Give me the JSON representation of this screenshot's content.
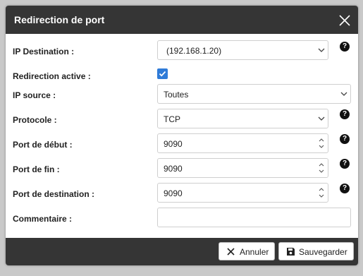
{
  "dialog": {
    "title": "Redirection de port",
    "close_icon": "close-icon"
  },
  "form": {
    "ip_destination": {
      "label": "IP Destination :",
      "value": "(192.168.1.20)",
      "help": "?"
    },
    "redirection_active": {
      "label": "Redirection active :",
      "checked": true
    },
    "ip_source": {
      "label": "IP source :",
      "value": "Toutes"
    },
    "protocole": {
      "label": "Protocole :",
      "value": "TCP",
      "help": "?"
    },
    "port_debut": {
      "label": "Port de début :",
      "value": "9090",
      "help": "?"
    },
    "port_fin": {
      "label": "Port de fin :",
      "value": "9090",
      "help": "?"
    },
    "port_destination": {
      "label": "Port de destination :",
      "value": "9090",
      "help": "?"
    },
    "commentaire": {
      "label": "Commentaire :",
      "value": ""
    }
  },
  "footer": {
    "cancel_label": "Annuler",
    "cancel_icon": "close-icon",
    "save_label": "Sauvegarder",
    "save_icon": "floppy-disk-icon"
  },
  "colors": {
    "header_bg": "#353535",
    "checkbox_accent": "#2f7bd8",
    "overlay": "#c9c9c9"
  }
}
